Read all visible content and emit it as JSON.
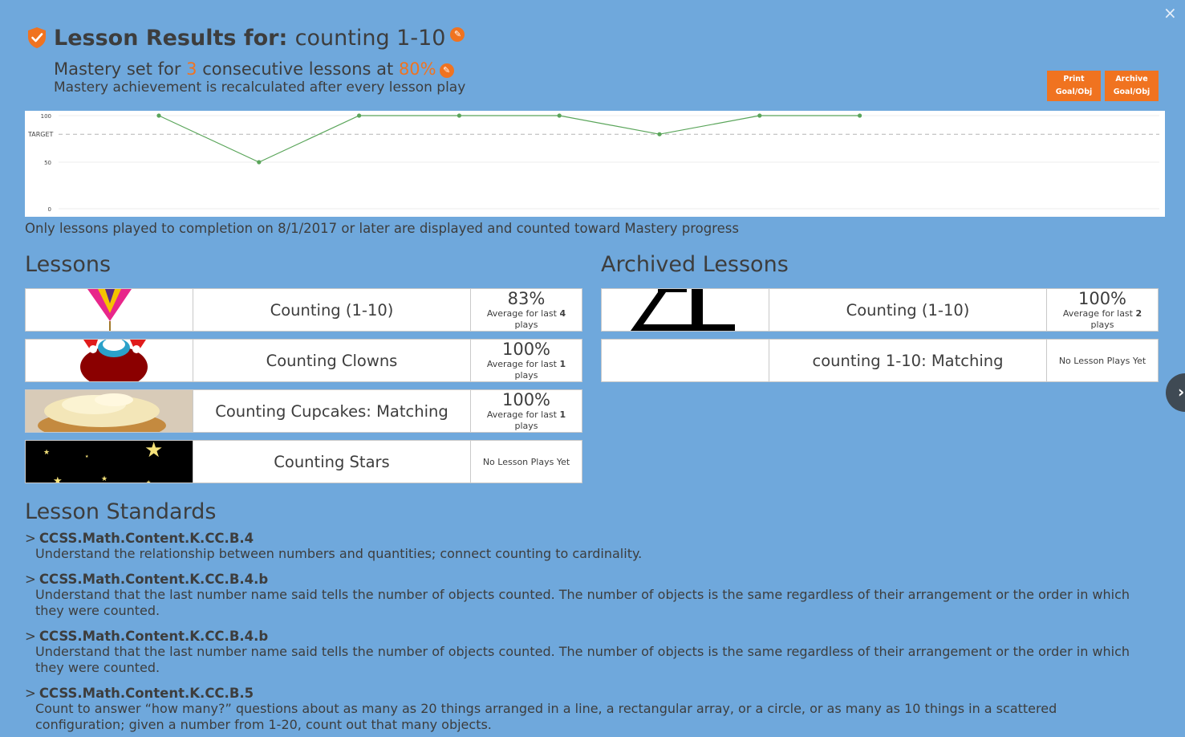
{
  "header": {
    "close_label": "×",
    "title_label": "Lesson Results for:",
    "title_value": "counting 1-10",
    "mastery_prefix": "Mastery set for",
    "mastery_count": "3",
    "mastery_mid": "consecutive lessons at",
    "mastery_pct": "80%",
    "mastery_note": "Mastery achievement is recalculated after every lesson play"
  },
  "actions": {
    "print_line1": "Print",
    "print_line2": "Goal/Obj",
    "archive_line1": "Archive",
    "archive_line2": "Goal/Obj"
  },
  "chart_data": {
    "type": "line",
    "y_ticks": [
      "100",
      "TARGET",
      "50",
      "0"
    ],
    "ylim": [
      0,
      100
    ],
    "target": 80,
    "values": [
      100,
      50,
      100,
      100,
      100,
      80,
      100,
      100
    ],
    "color": "#5aa55a"
  },
  "completion_note": "Only lessons played to completion on 8/1/2017 or later are displayed and counted toward Mastery progress",
  "lessons": {
    "title": "Lessons",
    "items": [
      {
        "name": "Counting (1-10)",
        "pct": "83%",
        "sub_prefix": "Average for last",
        "sub_count": "4",
        "sub_suffix": "plays"
      },
      {
        "name": "Counting Clowns",
        "pct": "100%",
        "sub_prefix": "Average for last",
        "sub_count": "1",
        "sub_suffix": "plays"
      },
      {
        "name": "Counting Cupcakes: Matching",
        "pct": "100%",
        "sub_prefix": "Average for last",
        "sub_count": "1",
        "sub_suffix": "plays"
      },
      {
        "name": "Counting Stars",
        "no_plays": "No Lesson Plays Yet"
      }
    ]
  },
  "archived": {
    "title": "Archived Lessons",
    "items": [
      {
        "name": "Counting (1-10)",
        "pct": "100%",
        "sub_prefix": "Average for last",
        "sub_count": "2",
        "sub_suffix": "plays"
      },
      {
        "name": "counting 1-10: Matching",
        "no_plays": "No Lesson Plays Yet"
      }
    ]
  },
  "standards": {
    "title": "Lesson Standards",
    "caret": ">",
    "items": [
      {
        "code": "CCSS.Math.Content.K.CC.B.4",
        "desc": "Understand the relationship between numbers and quantities; connect counting to cardinality."
      },
      {
        "code": "CCSS.Math.Content.K.CC.B.4.b",
        "desc": "Understand that the last number name said tells the number of objects counted. The number of objects is the same regardless of their arrangement or the order in which they were counted."
      },
      {
        "code": "CCSS.Math.Content.K.CC.B.4.b",
        "desc": "Understand that the last number name said tells the number of objects counted. The number of objects is the same regardless of their arrangement or the order in which they were counted."
      },
      {
        "code": "CCSS.Math.Content.K.CC.B.5",
        "desc": "Count to answer “how many?” questions about as many as 20 things arranged in a line, a rectangular array, or a circle, or as many as 10 things in a scattered configuration; given a number from 1-20, count out that many objects."
      }
    ]
  },
  "colors": {
    "background": "#6fa8dc",
    "accent": "#f07320",
    "text": "#3d3d3d"
  }
}
